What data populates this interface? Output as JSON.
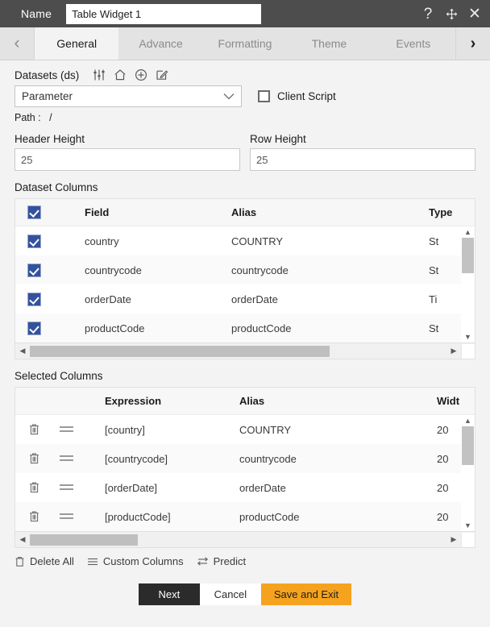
{
  "titlebar": {
    "name_label": "Name",
    "name_value": "Table Widget 1",
    "help_icon": "question-mark-icon",
    "move_icon": "move-icon",
    "close_icon": "close-icon"
  },
  "tabbar": {
    "prev_label": "‹",
    "next_label": "›",
    "tabs": [
      {
        "label": "General",
        "active": true
      },
      {
        "label": "Advance",
        "active": false
      },
      {
        "label": "Formatting",
        "active": false
      },
      {
        "label": "Theme",
        "active": false
      },
      {
        "label": "Events",
        "active": false
      }
    ]
  },
  "datasets": {
    "label": "Datasets (ds)",
    "icons": [
      "sliders-icon",
      "home-icon",
      "plus-circle-icon",
      "edit-icon"
    ],
    "selected": "Parameter",
    "chevron": "∨",
    "client_script_label": "Client Script",
    "client_script_checked": false,
    "path_label": "Path :",
    "path_value": "/"
  },
  "heights": {
    "header_height_label": "Header Height",
    "header_height_value": "25",
    "row_height_label": "Row Height",
    "row_height_value": "25"
  },
  "dataset_columns": {
    "title": "Dataset Columns",
    "header": {
      "check_all": true,
      "field": "Field",
      "alias": "Alias",
      "type": "Type"
    },
    "rows": [
      {
        "checked": true,
        "field": "country",
        "alias": "COUNTRY",
        "type": "St"
      },
      {
        "checked": true,
        "field": "countrycode",
        "alias": "countrycode",
        "type": "St"
      },
      {
        "checked": true,
        "field": "orderDate",
        "alias": "orderDate",
        "type": "Ti"
      },
      {
        "checked": true,
        "field": "productCode",
        "alias": "productCode",
        "type": "St"
      }
    ]
  },
  "selected_columns": {
    "title": "Selected Columns",
    "header": {
      "expression": "Expression",
      "alias": "Alias",
      "width": "Widt"
    },
    "rows": [
      {
        "delete_icon": "trash-icon",
        "drag_icon": "drag-handle-icon",
        "expression": "[country]",
        "alias": "COUNTRY",
        "width": "20"
      },
      {
        "delete_icon": "trash-icon",
        "drag_icon": "drag-handle-icon",
        "expression": "[countrycode]",
        "alias": "countrycode",
        "width": "20"
      },
      {
        "delete_icon": "trash-icon",
        "drag_icon": "drag-handle-icon",
        "expression": "[orderDate]",
        "alias": "orderDate",
        "width": "20"
      },
      {
        "delete_icon": "trash-icon",
        "drag_icon": "drag-handle-icon",
        "expression": "[productCode]",
        "alias": "productCode",
        "width": "20"
      }
    ]
  },
  "actions": {
    "delete_all": "Delete All",
    "custom_columns": "Custom Columns",
    "predict": "Predict"
  },
  "footer": {
    "next": "Next",
    "cancel": "Cancel",
    "save_and_exit": "Save and Exit"
  },
  "colors": {
    "titlebar_bg": "#4d4d4d",
    "tab_bg": "#e3e3e3",
    "active_tab_bg": "#f3f3f3",
    "checkbox_blue": "#33529e",
    "accent_orange": "#f5a31e",
    "next_black": "#2b2b2b"
  }
}
